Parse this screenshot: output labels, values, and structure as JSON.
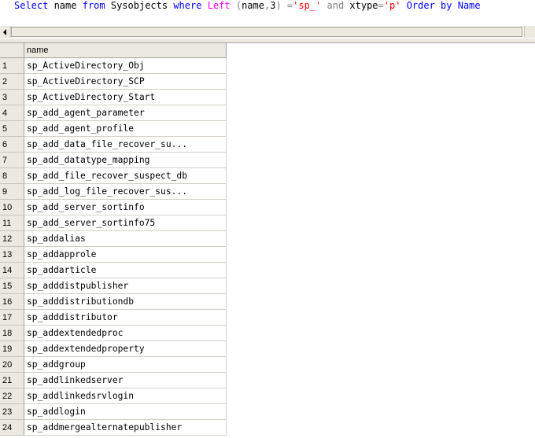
{
  "editor": {
    "query_tokens": [
      {
        "text": "Select",
        "cls": "kw"
      },
      {
        "text": " name ",
        "cls": "ident"
      },
      {
        "text": "from",
        "cls": "kw"
      },
      {
        "text": " Sysobjects ",
        "cls": "ident"
      },
      {
        "text": "where",
        "cls": "kw"
      },
      {
        "text": " ",
        "cls": "ident"
      },
      {
        "text": "Left",
        "cls": "fn"
      },
      {
        "text": " ",
        "cls": "ident"
      },
      {
        "text": "(",
        "cls": "gray"
      },
      {
        "text": "name",
        "cls": "ident"
      },
      {
        "text": ",",
        "cls": "gray"
      },
      {
        "text": "3",
        "cls": "ident"
      },
      {
        "text": ")",
        "cls": "gray"
      },
      {
        "text": " ",
        "cls": "ident"
      },
      {
        "text": "=",
        "cls": "gray"
      },
      {
        "text": "'sp_'",
        "cls": "str"
      },
      {
        "text": " ",
        "cls": "ident"
      },
      {
        "text": "and",
        "cls": "gray"
      },
      {
        "text": " xtype",
        "cls": "ident"
      },
      {
        "text": "=",
        "cls": "gray"
      },
      {
        "text": "'p'",
        "cls": "str"
      },
      {
        "text": " ",
        "cls": "ident"
      },
      {
        "text": "Order by",
        "cls": "kw"
      },
      {
        "text": " Name",
        "cls": "kw"
      }
    ]
  },
  "results": {
    "column_header": "name",
    "rows": [
      {
        "num": "1",
        "name": "sp_ActiveDirectory_Obj"
      },
      {
        "num": "2",
        "name": "sp_ActiveDirectory_SCP"
      },
      {
        "num": "3",
        "name": "sp_ActiveDirectory_Start"
      },
      {
        "num": "4",
        "name": "sp_add_agent_parameter"
      },
      {
        "num": "5",
        "name": "sp_add_agent_profile"
      },
      {
        "num": "6",
        "name": "sp_add_data_file_recover_su..."
      },
      {
        "num": "7",
        "name": "sp_add_datatype_mapping"
      },
      {
        "num": "8",
        "name": "sp_add_file_recover_suspect_db"
      },
      {
        "num": "9",
        "name": "sp_add_log_file_recover_sus..."
      },
      {
        "num": "10",
        "name": "sp_add_server_sortinfo"
      },
      {
        "num": "11",
        "name": "sp_add_server_sortinfo75"
      },
      {
        "num": "12",
        "name": "sp_addalias"
      },
      {
        "num": "13",
        "name": "sp_addapprole"
      },
      {
        "num": "14",
        "name": "sp_addarticle"
      },
      {
        "num": "15",
        "name": "sp_adddistpublisher"
      },
      {
        "num": "16",
        "name": "sp_adddistributiondb"
      },
      {
        "num": "17",
        "name": "sp_adddistributor"
      },
      {
        "num": "18",
        "name": "sp_addextendedproc"
      },
      {
        "num": "19",
        "name": "sp_addextendedproperty"
      },
      {
        "num": "20",
        "name": "sp_addgroup"
      },
      {
        "num": "21",
        "name": "sp_addlinkedserver"
      },
      {
        "num": "22",
        "name": "sp_addlinkedsrvlogin"
      },
      {
        "num": "23",
        "name": "sp_addlogin"
      },
      {
        "num": "24",
        "name": "sp_addmergealternatepublisher"
      }
    ]
  }
}
